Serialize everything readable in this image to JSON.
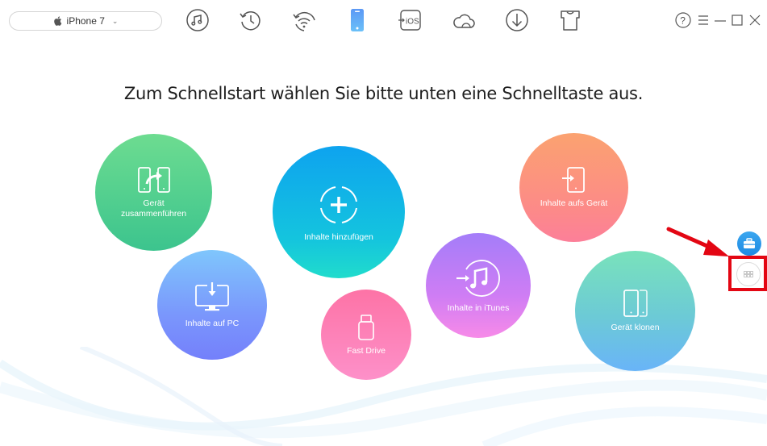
{
  "toolbar": {
    "device_name": "iPhone 7",
    "device_icon": "apple-icon",
    "tools": [
      {
        "name": "music-icon",
        "label": "Audio"
      },
      {
        "name": "history-icon",
        "label": "Backup"
      },
      {
        "name": "wifi-restore-icon",
        "label": "Air Backup"
      },
      {
        "name": "phone-icon",
        "label": "Device",
        "active": true
      },
      {
        "name": "ios-mover-icon",
        "label": "iOS Mover"
      },
      {
        "name": "cloud-icon",
        "label": "iCloud"
      },
      {
        "name": "download-icon",
        "label": "Download"
      },
      {
        "name": "tshirt-icon",
        "label": "Theme"
      }
    ],
    "window_controls": [
      "help-icon",
      "menu-icon",
      "minimize-icon",
      "maximize-icon",
      "close-icon"
    ]
  },
  "main": {
    "headline": "Zum Schnellstart wählen Sie bitte unten eine Schnelltaste aus.",
    "shortcuts": [
      {
        "id": "merge",
        "label_line1": "Gerät",
        "label_line2": "zusammenführen",
        "icon": "merge-devices-icon",
        "color_top": "#6ddc90",
        "color_bottom": "#3cc48e"
      },
      {
        "id": "add",
        "label": "Inhalte hinzufügen",
        "icon": "add-content-icon",
        "color_top": "#0ea3ef",
        "color_bottom": "#20dccc"
      },
      {
        "id": "to-device",
        "label": "Inhalte aufs Gerät",
        "icon": "to-device-icon",
        "color_top": "#fba270",
        "color_bottom": "#fc7f99"
      },
      {
        "id": "to-pc",
        "label": "Inhalte auf PC",
        "icon": "to-pc-icon",
        "color_top": "#7fc6fc",
        "color_bottom": "#7480fb"
      },
      {
        "id": "fast-drive",
        "label": "Fast Drive",
        "icon": "usb-drive-icon",
        "color_top": "#fd73a6",
        "color_bottom": "#fd90c9"
      },
      {
        "id": "to-itunes",
        "label": "Inhalte in iTunes",
        "icon": "to-itunes-icon",
        "color_top": "#a47df9",
        "color_bottom": "#f78ae8"
      },
      {
        "id": "clone",
        "label": "Gerät klonen",
        "icon": "clone-device-icon",
        "color_top": "#79e2bb",
        "color_bottom": "#69b4f8"
      }
    ]
  },
  "side": {
    "toolbox_icon": "toolbox-icon",
    "more_icon": "grid-icon",
    "highlight_color": "#e30613"
  }
}
